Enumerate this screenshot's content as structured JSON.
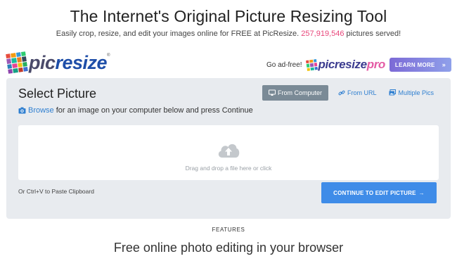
{
  "hero": {
    "title": "The Internet's Original Picture Resizing Tool",
    "subtitle_prefix": "Easily crop, resize, and edit your images online for FREE at PicResize.",
    "pictures_served": "257,919,546",
    "subtitle_suffix": "pictures served!"
  },
  "logo": {
    "text_part1": "pic",
    "text_part2": "resize",
    "registered": "®"
  },
  "promo": {
    "label": "Go ad-free!",
    "pro_text_part1": "picresize",
    "pro_text_part2": "pro",
    "learn_more": "LEARN MORE",
    "learn_more_arrow": "»"
  },
  "panel": {
    "title": "Select Picture",
    "tabs": [
      {
        "label": "From Computer",
        "icon": "monitor-icon",
        "active": true
      },
      {
        "label": "From URL",
        "icon": "link-icon",
        "active": false
      },
      {
        "label": "Multiple Pics",
        "icon": "images-icon",
        "active": false
      }
    ],
    "browse_link": "Browse",
    "browse_rest": "for an image on your computer below and press Continue",
    "dropzone_text": "Drag and drop a file here or click",
    "paste_hint": "Or Ctrl+V to Paste Clipboard",
    "continue_label": "CONTINUE TO EDIT PICTURE",
    "continue_arrow": "→"
  },
  "features": {
    "label": "FEATURES",
    "heading": "Free online photo editing in your browser"
  },
  "colors": {
    "accent": "#3f8ce8",
    "link": "#2f7fd0",
    "count": "#e8457a",
    "panel_bg": "#e8ebef",
    "active_tab": "#7a8a96"
  }
}
